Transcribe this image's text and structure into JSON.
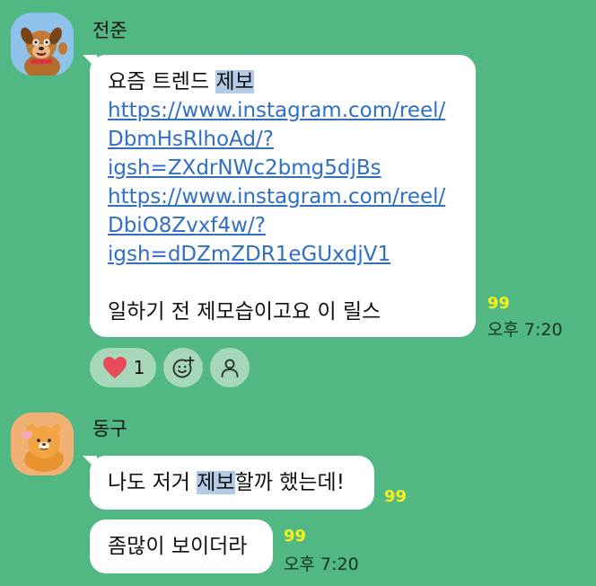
{
  "chat": {
    "messages": [
      {
        "sender": "전준",
        "avatar_icon": "dog-character-avatar-icon",
        "lines": [
          {
            "text": "요즘 트렌드 ",
            "highlight": "제보",
            "type": "text"
          },
          {
            "text": "https://www.instagram.com/reel/",
            "type": "link"
          },
          {
            "text": "DbmHsRlhoAd/?",
            "type": "link"
          },
          {
            "text": "igsh=ZXdrNWc2bmg5djBs",
            "type": "link"
          },
          {
            "text": "https://www.instagram.com/reel/",
            "type": "link"
          },
          {
            "text": "DbiO8Zvxf4w/?",
            "type": "link"
          },
          {
            "text": "igsh=dDZmZDR1eGUxdjV1",
            "type": "link"
          },
          {
            "text": "",
            "type": "blank"
          },
          {
            "text": "일하기 전 제모습이고요 이 릴스",
            "type": "text"
          }
        ],
        "unread": "99",
        "time": "오후 7:20"
      },
      {
        "sender": "동구",
        "avatar_icon": "lion-character-avatar-icon",
        "bubbles": [
          {
            "before": "나도 저거 ",
            "highlight": "제보",
            "after": "할까 했는데!",
            "unread": "99"
          },
          {
            "text": "좀많이 보이더라",
            "unread": "99",
            "time": "오후 7:20"
          }
        ]
      }
    ],
    "reactions": [
      {
        "icon": "heart-icon",
        "count": "1"
      },
      {
        "icon": "add-emoji-icon"
      },
      {
        "icon": "person-icon"
      }
    ],
    "colors": {
      "background": "#51b883",
      "bubble": "#ffffff",
      "link": "#2f6fc6",
      "unread": "#f7f01a",
      "highlight": "#b4cbe6",
      "reaction_chip": "#a7d7bb",
      "heart": "#e84a57"
    }
  }
}
